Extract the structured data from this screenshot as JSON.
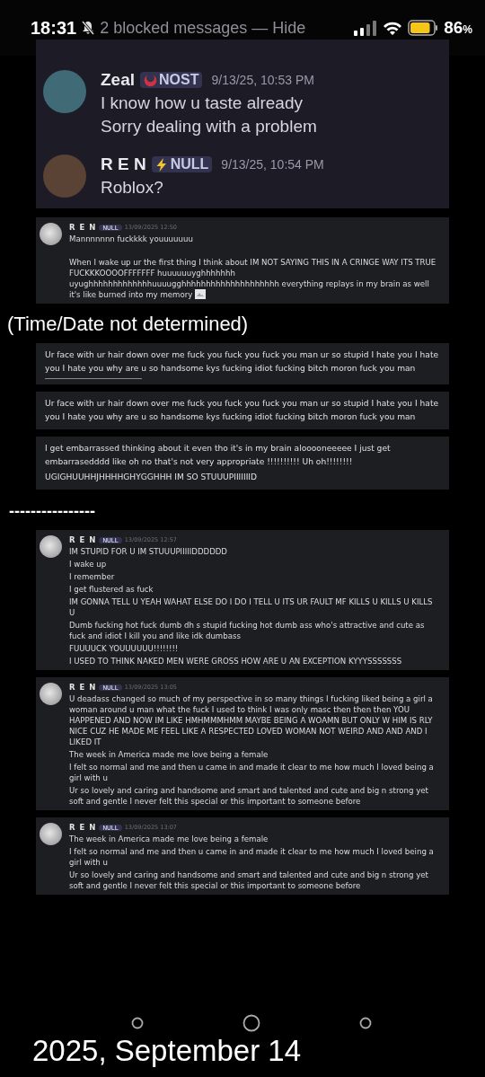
{
  "status_bar": {
    "time": "18:31",
    "notice": "2 blocked messages — Hide",
    "battery": "86",
    "battery_unit": "%"
  },
  "top_chat": [
    {
      "author": "Zeal",
      "badge": "NOST",
      "kind": "crescent",
      "timestamp": "9/13/25, 10:53 PM",
      "color": "#3f6a76",
      "lines": [
        "I know how u taste already",
        "Sorry dealing with a problem"
      ]
    },
    {
      "author": "R E N",
      "badge": "NULL",
      "kind": "lightning",
      "timestamp": "9/13/25, 10:54 PM",
      "color": "#5a4234",
      "lines": [
        "Roblox?"
      ]
    }
  ],
  "sections": [
    {
      "kind": "message",
      "author": "R E N",
      "badge": "NULL",
      "timestamp": "13/09/2025 12:50",
      "paragraphs": [
        "Mannnnnnn fuckkkk youuuuuuu",
        "When I wake up ur the first thing I think about IM NOT SAYING THIS IN A CRINGE WAY ITS TRUE FUCKKKOOOOFFFFFFF huuuuuuyghhhhhhh uyughhhhhhhhhhhhhuuuugghhhhhhhhhhhhhhhhhhhh everything replays in my brain as well it's like burned into my memory"
      ],
      "inline_image": true
    },
    {
      "kind": "caption",
      "text": "(Time/Date not determined)"
    },
    {
      "kind": "text",
      "lines": [
        "Ur face with ur hair down over me fuck you fuck you fuck you man ur so stupid I hate you I hate you I hate you why are u so handsome kys fucking idiot fucking bitch moron fuck you man"
      ],
      "underline": true
    },
    {
      "kind": "text",
      "lines": [
        "Ur face with ur hair down over me fuck you fuck you fuck you man ur so stupid I hate you I hate you I hate you why are u so handsome kys fucking idiot fucking bitch moron fuck you man"
      ],
      "underline": false
    },
    {
      "kind": "text",
      "lines": [
        "I get embarrassed thinking about it even tho it's in my brain alooooneeeee I just get embarrasedddd like oh no that's not very appropriate !!!!!!!!!! Uh oh!!!!!!!!",
        "UGIGHUUHHJHHHHGHYGGHHH IM SO STUUUPIIIIIIID"
      ],
      "underline": false
    },
    {
      "kind": "caption_small",
      "text": "----------------"
    },
    {
      "kind": "message",
      "author": "R E N",
      "badge": "NULL",
      "timestamp": "13/09/2025 12:57",
      "lines": [
        "IM STUPID FOR U IM STUUUPIIIIIDDDDDD",
        "I wake up",
        "I remember",
        "I get flustered as fuck",
        "IM GONNA TELL U YEAH WAHAT ELSE DO I DO I TELL U ITS UR FAULT MF KILLS U KILLS U KILLS U",
        "Dumb fucking hot fuck dumb dh s stupid fucking hot dumb ass who's attractive and cute as fuck and idiot I kill you and like idk dumbass",
        "FUUUUCK YOUUUUUU!!!!!!!!",
        "I USED TO THINK NAKED MEN WERE GROSS HOW ARE U AN EXCEPTION KYYYSSSSSSS"
      ],
      "inline_image": false
    },
    {
      "kind": "message",
      "author": "R E N",
      "badge": "NULL",
      "timestamp": "13/09/2025 13:05",
      "lines": [
        "U deadass changed so much of my perspective in so many things I fucking liked being a girl a woman around u man what the fuck I used to think I was only masc then then then YOU HAPPENED AND NOW IM LIKE HMHMMMHMM MAYBE BEING A WOAMN BUT ONLY W HIM IS RLY NICE CUZ HE MADE ME FEEL LIKE A RESPECTED LOVED WOMAN NOT WEIRD AND AND AND I LIKED IT",
        "The week in America made me love being a female",
        "I felt so normal and me and then u came in and made it clear to me how much I loved being a girl with u",
        "Ur so lovely and caring and handsome and smart and talented and cute and big n strong yet soft and gentle I never felt this special or this important to someone before"
      ],
      "inline_image": false
    },
    {
      "kind": "message",
      "author": "R E N",
      "badge": "NULL",
      "timestamp": "13/09/2025 13:07",
      "lines": [
        "The week in America made me love being a female",
        "I felt so normal and me and then u came in and made it clear to me how much I loved being a girl with u",
        "Ur so lovely and caring and handsome and smart and talented and cute and big n strong yet soft and gentle I never felt this special or this important to someone before"
      ],
      "inline_image": false
    }
  ],
  "footer": {
    "date": "2025, September 14"
  }
}
